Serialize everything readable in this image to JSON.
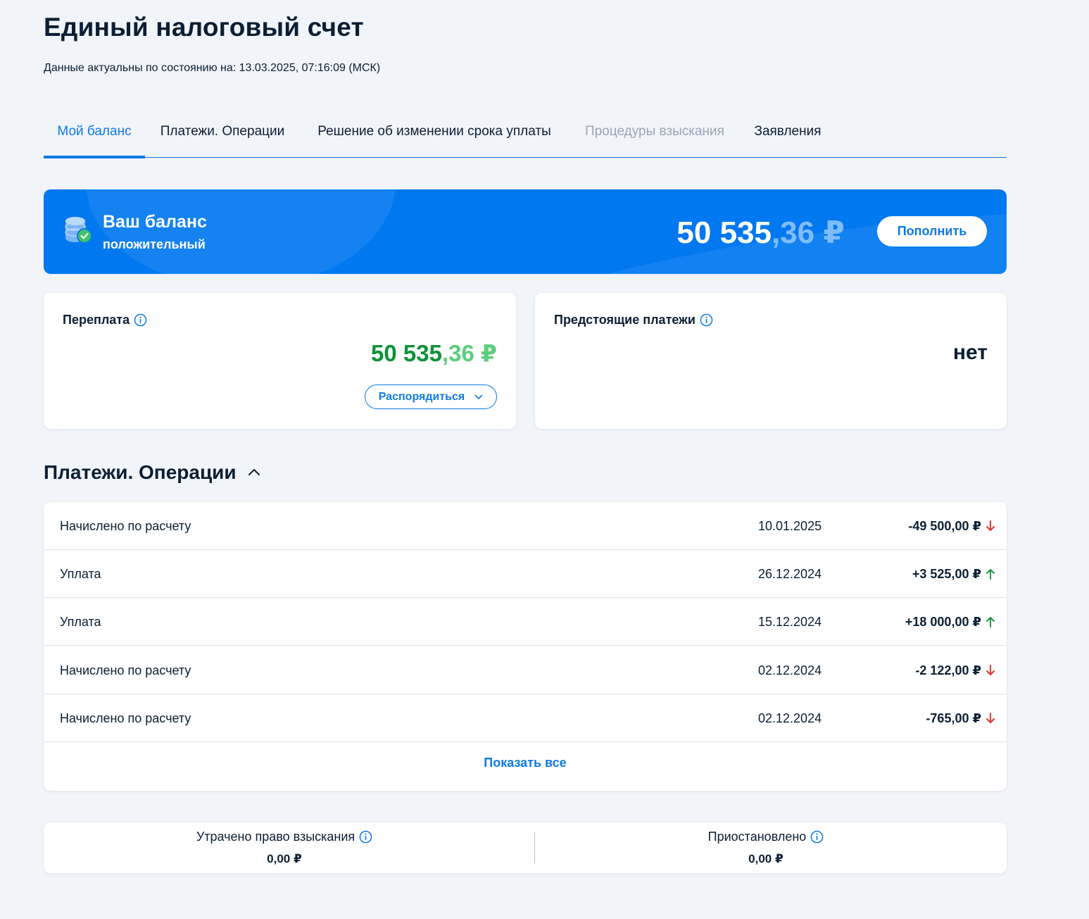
{
  "header": {
    "title": "Единый налоговый счет",
    "updated": "Данные актуальны по состоянию на: 13.03.2025, 07:16:09 (МСК)"
  },
  "tabs": [
    {
      "label": "Мой баланс",
      "state": "active"
    },
    {
      "label": "Платежи. Операции",
      "state": "normal"
    },
    {
      "label": "Решение об изменении срока уплаты",
      "state": "normal"
    },
    {
      "label": "Процедуры взыскания",
      "state": "disabled"
    },
    {
      "label": "Заявления",
      "state": "normal"
    }
  ],
  "balance": {
    "title": "Ваш баланс",
    "status": "положительный",
    "amount_int": "50 535",
    "amount_frac": ",36 ₽",
    "topup_label": "Пополнить",
    "icon": "coins-check-icon"
  },
  "overpayment": {
    "label": "Переплата",
    "amount_int": "50 535",
    "amount_frac": ",36 ₽",
    "manage_label": "Распорядиться"
  },
  "upcoming": {
    "label": "Предстоящие платежи",
    "value": "нет"
  },
  "operations": {
    "title": "Платежи. Операции",
    "rows": [
      {
        "name": "Начислено по расчету",
        "date": "10.01.2025",
        "amount": "-49 500,00 ₽",
        "direction": "down"
      },
      {
        "name": "Уплата",
        "date": "26.12.2024",
        "amount": "+3 525,00 ₽",
        "direction": "up"
      },
      {
        "name": "Уплата",
        "date": "15.12.2024",
        "amount": "+18 000,00 ₽",
        "direction": "up"
      },
      {
        "name": "Начислено по расчету",
        "date": "02.12.2024",
        "amount": "-2 122,00 ₽",
        "direction": "down"
      },
      {
        "name": "Начислено по расчету",
        "date": "02.12.2024",
        "amount": "-765,00 ₽",
        "direction": "down"
      }
    ],
    "show_all": "Показать все"
  },
  "summary": {
    "lost": {
      "label": "Утрачено право взыскания",
      "value": "0,00 ₽"
    },
    "suspended": {
      "label": "Приостановлено",
      "value": "0,00 ₽"
    }
  },
  "colors": {
    "accent": "#0d7aea",
    "card_blue": "#0078f0",
    "positive": "#0b9336",
    "negative_arrow": "#e8352b",
    "positive_arrow": "#1a9a3c"
  }
}
